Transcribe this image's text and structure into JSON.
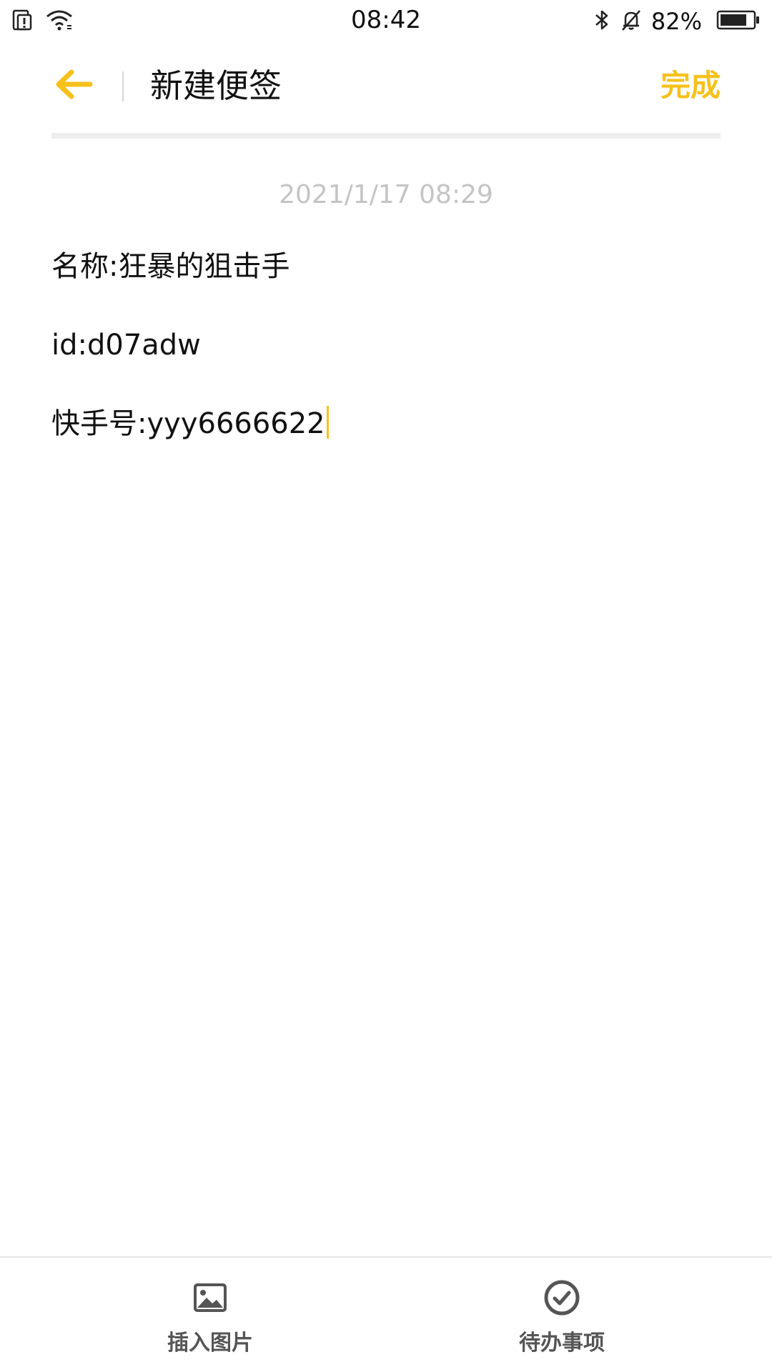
{
  "status_bar": {
    "time": "08:42",
    "battery_percent": "82%",
    "battery_level": 0.82,
    "icons": [
      "sim-icon",
      "wifi-icon",
      "bluetooth-icon",
      "mute-bell-icon",
      "battery-icon"
    ]
  },
  "header": {
    "title": "新建便签",
    "done_label": "完成"
  },
  "note": {
    "date": "2021/1/17 08:29",
    "lines": [
      "名称:狂暴的狙击手",
      "id:d07adw",
      "快手号:yyy6666622"
    ]
  },
  "toolbar": {
    "insert_image_label": "插入图片",
    "todo_label": "待办事项"
  },
  "colors": {
    "accent": "#F6C11B",
    "text": "#111111",
    "date_text": "#C4C4C4",
    "toolbar_icon": "#555555"
  }
}
